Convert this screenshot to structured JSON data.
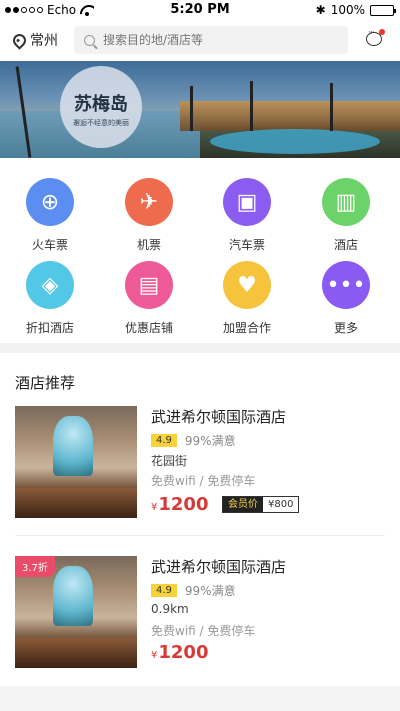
{
  "status_bar": {
    "carrier": "Echo",
    "time": "5:20 PM",
    "battery": "100%"
  },
  "header": {
    "city": "常州",
    "search_placeholder": "搜索目的地/酒店等"
  },
  "banner": {
    "title": "苏梅岛",
    "subtitle": "邂逅不经意的美丽"
  },
  "categories": [
    {
      "label": "火车票",
      "icon": "train-icon",
      "color": "#5b8ef0"
    },
    {
      "label": "机票",
      "icon": "plane-icon",
      "color": "#ef6b4e"
    },
    {
      "label": "汽车票",
      "icon": "bus-icon",
      "color": "#8b5cf0"
    },
    {
      "label": "酒店",
      "icon": "hotel-icon",
      "color": "#6cd36a"
    },
    {
      "label": "折扣酒店",
      "icon": "discount-tag-icon",
      "color": "#53c8e6"
    },
    {
      "label": "优惠店铺",
      "icon": "shop-icon",
      "color": "#ee5a98"
    },
    {
      "label": "加盟合作",
      "icon": "handshake-icon",
      "color": "#f6c43c"
    },
    {
      "label": "更多",
      "icon": "more-icon",
      "color": "#8a5af2"
    }
  ],
  "section_title": "酒店推荐",
  "hotels": [
    {
      "name": "武进希尔顿国际酒店",
      "score": "4.9",
      "satisfaction": "99%满意",
      "area": "花园街",
      "facilities": "免费wifi / 免费停车",
      "currency": "¥",
      "price": "1200",
      "member_label": "会员价",
      "member_price": "¥800"
    },
    {
      "tag": "3.7折",
      "name": "武进希尔顿国际酒店",
      "score": "4.9",
      "satisfaction": "99%满意",
      "area": "0.9km",
      "facilities": "免费wifi / 免费停车",
      "currency": "¥",
      "price": "1200"
    }
  ]
}
